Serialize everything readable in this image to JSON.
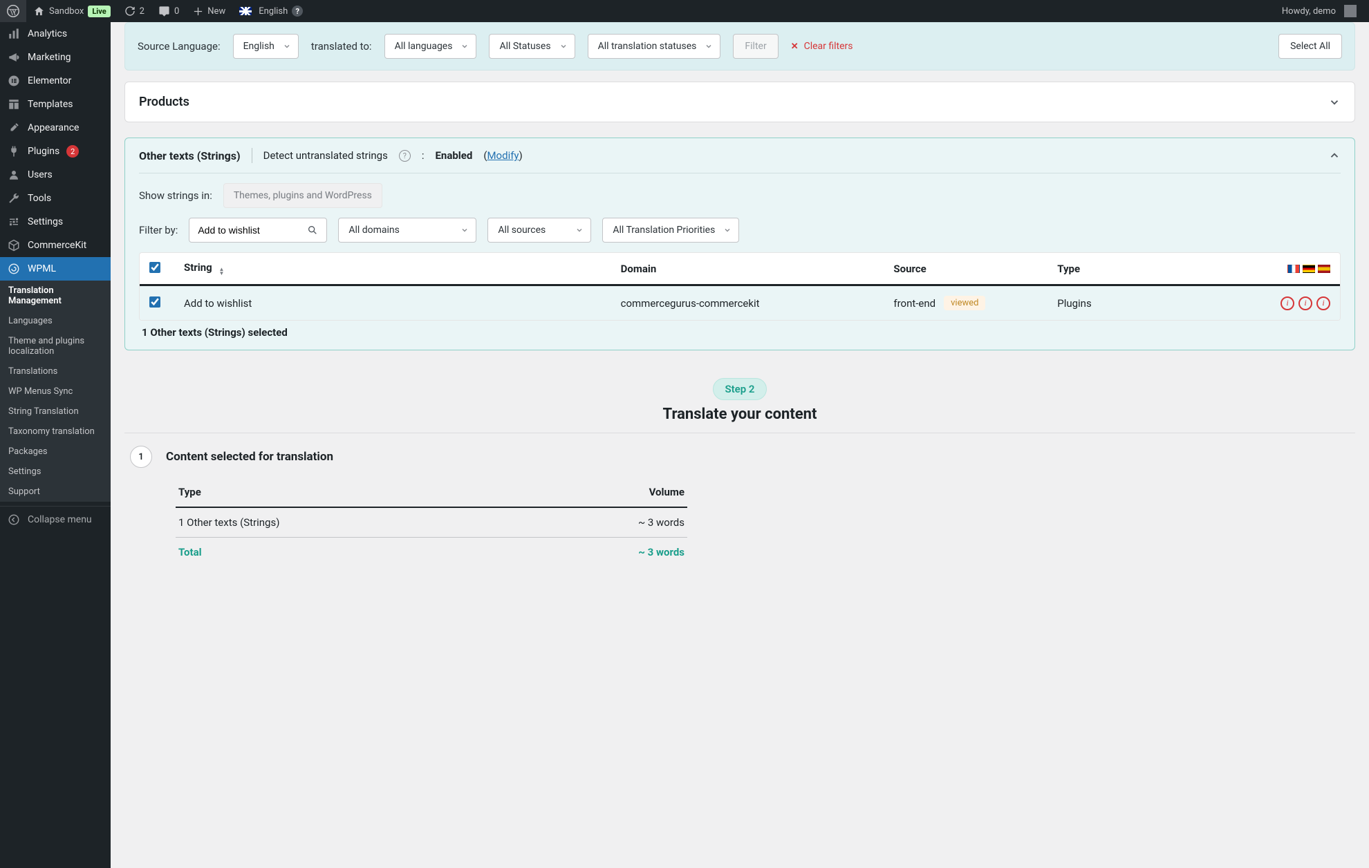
{
  "adminbar": {
    "site_name": "Sandbox",
    "live": "Live",
    "refresh_count": "2",
    "comments_count": "0",
    "new_label": "New",
    "language": "English",
    "howdy": "Howdy, demo"
  },
  "sidebar": {
    "items": [
      {
        "icon": "analytics",
        "label": "Analytics"
      },
      {
        "icon": "megaphone",
        "label": "Marketing"
      },
      {
        "icon": "elementor",
        "label": "Elementor"
      },
      {
        "icon": "templates",
        "label": "Templates"
      },
      {
        "icon": "appearance",
        "label": "Appearance"
      },
      {
        "icon": "plugins",
        "label": "Plugins",
        "badge": "2"
      },
      {
        "icon": "users",
        "label": "Users"
      },
      {
        "icon": "tools",
        "label": "Tools"
      },
      {
        "icon": "settings",
        "label": "Settings"
      },
      {
        "icon": "commercekit",
        "label": "CommerceKit"
      },
      {
        "icon": "wpml",
        "label": "WPML",
        "current": true
      }
    ],
    "submenu": [
      {
        "label": "Translation Management",
        "current": true
      },
      {
        "label": "Languages"
      },
      {
        "label": "Theme and plugins localization"
      },
      {
        "label": "Translations"
      },
      {
        "label": "WP Menus Sync"
      },
      {
        "label": "String Translation"
      },
      {
        "label": "Taxonomy translation"
      },
      {
        "label": "Packages"
      },
      {
        "label": "Settings"
      },
      {
        "label": "Support"
      }
    ],
    "collapse": "Collapse menu"
  },
  "filterbar": {
    "source_label": "Source Language:",
    "source_value": "English",
    "translated_to": "translated to:",
    "lang_value": "All languages",
    "status_value": "All Statuses",
    "trans_status_value": "All translation statuses",
    "filter_btn": "Filter",
    "clear": "Clear filters",
    "select_all": "Select All"
  },
  "products_panel": {
    "title": "Products"
  },
  "strings_panel": {
    "title": "Other texts (Strings)",
    "detect": "Detect untranslated strings",
    "enabled": "Enabled",
    "modify": "Modify",
    "show_strings_label": "Show strings in:",
    "themes_placeholder": "Themes, plugins and WordPress",
    "filter_by_label": "Filter by:",
    "search_value": "Add to wishlist",
    "domains_value": "All domains",
    "sources_value": "All sources",
    "priorities_value": "All Translation Priorities",
    "columns": {
      "string": "String",
      "domain": "Domain",
      "source": "Source",
      "type": "Type"
    },
    "rows": [
      {
        "string": "Add to wishlist",
        "domain": "commercegurus-commercekit",
        "source": "front-end",
        "tag": "viewed",
        "type": "Plugins",
        "checked": true
      }
    ],
    "selection_note": "1 Other texts (Strings) selected"
  },
  "step2": {
    "badge": "Step 2",
    "title": "Translate your content",
    "number": "1",
    "panel_title": "Content selected for translation",
    "col_type": "Type",
    "col_volume": "Volume",
    "row_type": "1 Other texts (Strings)",
    "row_volume": "~ 3 words",
    "total_label": "Total",
    "total_volume": "~ 3 words"
  }
}
